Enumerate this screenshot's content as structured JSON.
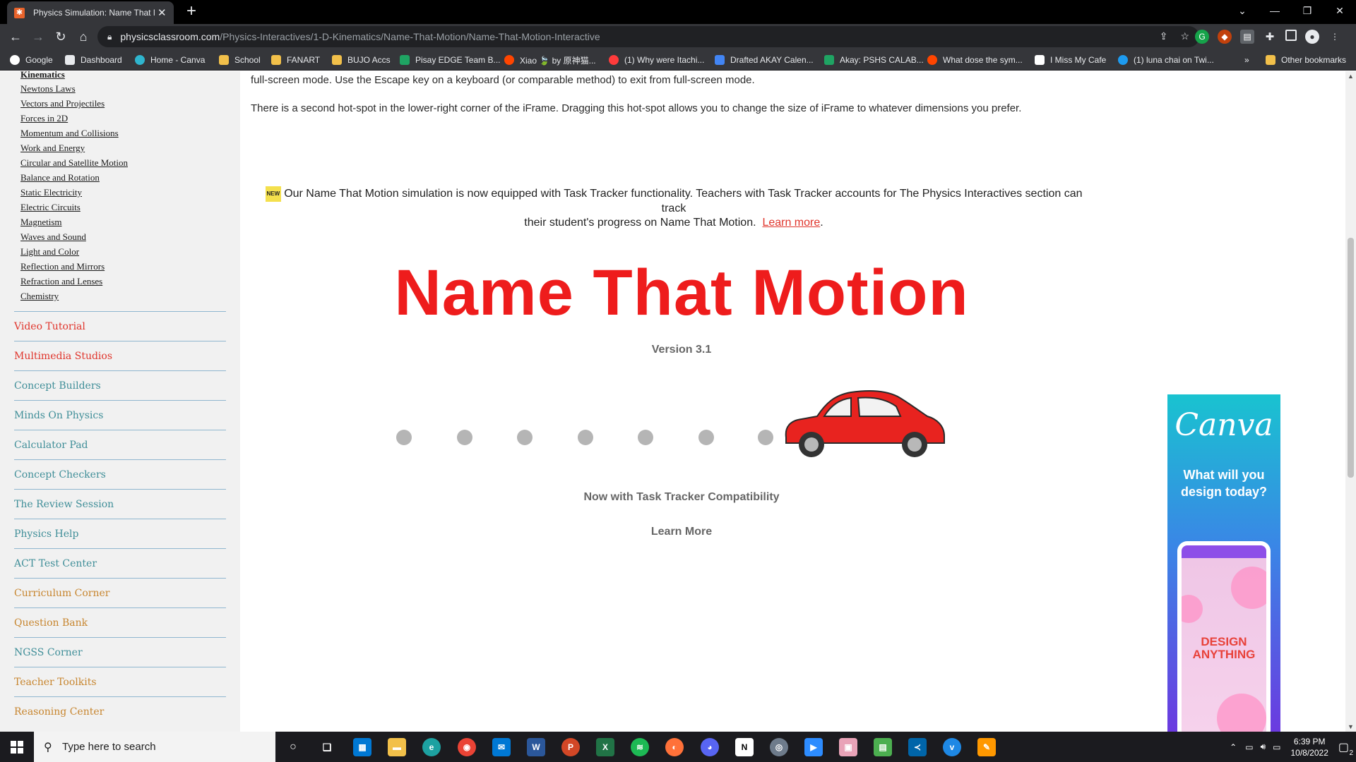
{
  "browser": {
    "tab_title": "Physics Simulation: Name That M",
    "url_host": "physicsclassroom.com",
    "url_path": "/Physics-Interactives/1-D-Kinematics/Name-That-Motion/Name-That-Motion-Interactive",
    "bookmarks": [
      "Google",
      "Dashboard",
      "Home - Canva",
      "School",
      "FANART",
      "BUJO Accs",
      "Pisay EDGE Team B...",
      "Xiao 🍃 by 原神猫...",
      "(1) Why were Itachi...",
      "Drafted AKAY Calen...",
      "Akay: PSHS CALAB...",
      "What dose the sym...",
      "I Miss My Cafe",
      "(1) luna chai on Twi..."
    ],
    "other_bookmarks": "Other bookmarks"
  },
  "sidebar": {
    "sub_links": [
      "Kinematics",
      "Newtons Laws",
      "Vectors and Projectiles",
      "Forces in 2D",
      "Momentum and Collisions",
      "Work and Energy",
      "Circular and Satellite Motion",
      "Balance and Rotation",
      "Static Electricity",
      "Electric Circuits",
      "Magnetism",
      "Waves and Sound",
      "Light and Color",
      "Reflection and Mirrors",
      "Refraction and Lenses",
      "Chemistry"
    ],
    "sections": [
      {
        "label": "Video Tutorial",
        "color": "#e0342b"
      },
      {
        "label": "Multimedia Studios",
        "color": "#e0342b"
      },
      {
        "label": "Concept Builders",
        "color": "#3f8e98"
      },
      {
        "label": "Minds On Physics",
        "color": "#3f8e98"
      },
      {
        "label": "Calculator Pad",
        "color": "#3f8e98"
      },
      {
        "label": "Concept Checkers",
        "color": "#3f8e98"
      },
      {
        "label": "The Review Session",
        "color": "#3f8e98"
      },
      {
        "label": "Physics Help",
        "color": "#3f8e98"
      },
      {
        "label": "ACT Test Center",
        "color": "#3f8e98"
      },
      {
        "label": "Curriculum Corner",
        "color": "#c7852e"
      },
      {
        "label": "Question Bank",
        "color": "#c7852e"
      },
      {
        "label": "NGSS Corner",
        "color": "#3f8e98"
      },
      {
        "label": "Teacher Toolkits",
        "color": "#c7852e"
      },
      {
        "label": "Reasoning Center",
        "color": "#c7852e"
      }
    ]
  },
  "content": {
    "para1": "full-screen mode. Use the Escape key on a keyboard (or comparable method) to exit from full-screen mode.",
    "para2": "There is a second hot-spot in the lower-right corner of the iFrame. Dragging this hot-spot allows you to change the size of iFrame to whatever dimensions you prefer.",
    "new_badge": "NEW",
    "notice_line1": "Our Name That Motion simulation is now equipped with Task Tracker functionality. Teachers with Task Tracker accounts for The Physics Interactives section can track",
    "notice_line2": "their student's progress on Name That Motion.",
    "notice_link": "Learn more",
    "notice_end": ".",
    "sim_title": "Name That Motion",
    "version": "Version 3.1",
    "compat": "Now with Task Tracker Compatibility",
    "learn_more": "Learn More"
  },
  "ad": {
    "logo": "Canva",
    "tagline": "What will you design today?",
    "phone_text": "DESIGN ANYTHING"
  },
  "taskbar": {
    "search_placeholder": "Type here to search",
    "time": "6:39 PM",
    "date": "10/8/2022",
    "notifications": "2"
  },
  "colors": {
    "title_red": "#ee1c1c",
    "car_red": "#e8231f",
    "dot_gray": "#b5b5b5"
  }
}
